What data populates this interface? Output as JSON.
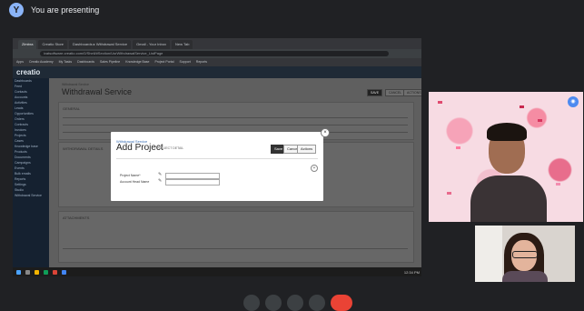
{
  "meet": {
    "presenting_text": "You are presenting",
    "presenter_initial": "Y"
  },
  "browser": {
    "tabs": [
      "Zimbra",
      "Creatio Store",
      "Dashboards ▸ Withdrawal Service",
      "Gmail - Your Inbox",
      "New Tab"
    ],
    "url": "ivatsoftware.creatio.com/0/Shell/#Section/UsrWithdrawalService_ListPage",
    "bookmarks": [
      "Apps",
      "Creatio Academy",
      "My Tasks",
      "Dashboards",
      "Sales Pipeline",
      "Knowledge Base",
      "Project Portal",
      "Support",
      "Reports"
    ]
  },
  "app": {
    "logo": "creatio",
    "sidebar_items": [
      "Dashboards",
      "Feed",
      "Contacts",
      "Accounts",
      "Activities",
      "Leads",
      "Opportunities",
      "Orders",
      "Contracts",
      "Invoices",
      "Projects",
      "Cases",
      "Knowledge base",
      "Products",
      "Documents",
      "Campaigns",
      "Events",
      "Bulk emails",
      "Reports",
      "Settings",
      "Studio",
      "Withdrawal Service"
    ],
    "breadcrumb": "Withdrawal Service",
    "page_title": "Withdrawal Service",
    "section1": "GENERAL",
    "section2": "WITHDRAWAL DETAILS",
    "section3": "ATTACHMENTS",
    "save": "SAVE",
    "cancel": "CANCEL",
    "actions": "ACTIONS"
  },
  "modal": {
    "crumb": "Withdrawal Service",
    "title": "Add Project",
    "subtitle": "PROJECT DETAIL",
    "save": "Save",
    "cancel": "Cancel",
    "actions": "Actions",
    "field1_label": "Project Name*",
    "field2_label": "Account Head Name",
    "close_glyph": "×",
    "plus_glyph": "+"
  },
  "taskbar": {
    "time": "12:34 PM"
  },
  "colors": {
    "meet_bg": "#202124",
    "accent": "#8ab4f8",
    "speaking": "#4d8af0",
    "leave": "#ea4335"
  }
}
